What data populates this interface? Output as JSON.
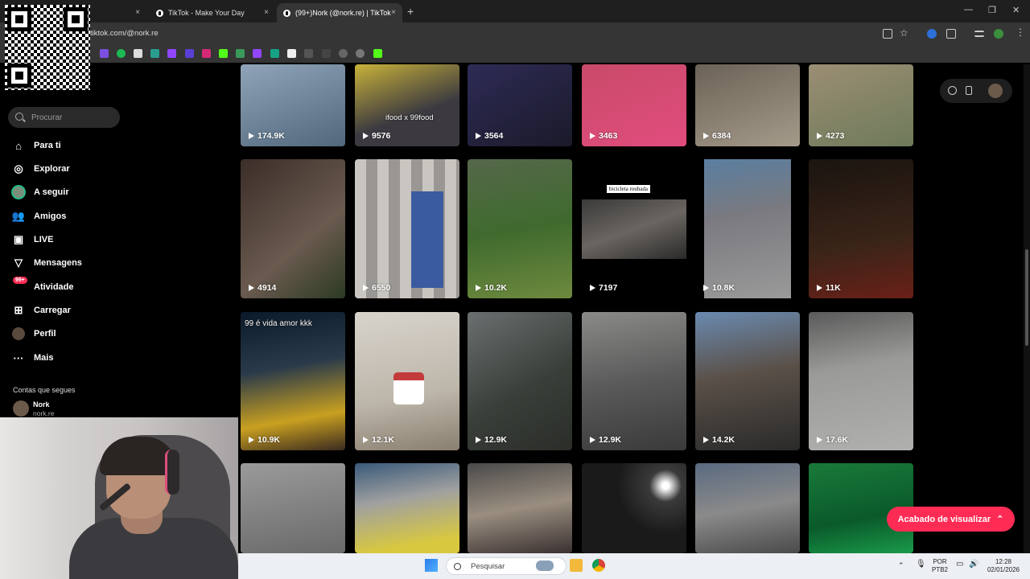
{
  "browser": {
    "tabs": [
      {
        "label": "TikTok - Make Your Day",
        "close": "×"
      },
      {
        "label": "(99+)Nork (@nork.re) | TikTok",
        "close": "×"
      }
    ],
    "new_tab": "+",
    "url": "tiktok.com/@nork.re",
    "window_controls": [
      "—",
      "❐",
      "✕"
    ]
  },
  "sidebar": {
    "search_placeholder": "Procurar",
    "items": [
      {
        "label": "Para ti",
        "icon": "home-icon"
      },
      {
        "label": "Explorar",
        "icon": "compass-icon"
      },
      {
        "label": "A seguir",
        "icon": "avatar-icon"
      },
      {
        "label": "Amigos",
        "icon": "friends-icon"
      },
      {
        "label": "LIVE",
        "icon": "live-icon"
      },
      {
        "label": "Mensagens",
        "icon": "messages-icon"
      },
      {
        "label": "Atividade",
        "icon": "activity-icon",
        "badge": "99+"
      },
      {
        "label": "Carregar",
        "icon": "upload-icon"
      },
      {
        "label": "Perfil",
        "icon": "profile-icon"
      },
      {
        "label": "Mais",
        "icon": "more-icon"
      }
    ],
    "following_title": "Contas que segues",
    "following": [
      {
        "name": "Nork",
        "handle": "nork.re"
      }
    ]
  },
  "videos": [
    {
      "views": "174.9K"
    },
    {
      "views": "9576",
      "overlay": "ifood x 99food"
    },
    {
      "views": "3564"
    },
    {
      "views": "3463"
    },
    {
      "views": "6384"
    },
    {
      "views": "4273"
    },
    {
      "views": "4914"
    },
    {
      "views": "6550"
    },
    {
      "views": "10.2K"
    },
    {
      "views": "7197",
      "overlay": "bicicleta roubada"
    },
    {
      "views": "10.8K"
    },
    {
      "views": "11K"
    },
    {
      "views": "10.9K",
      "overlay": "99 é vida amor kkk"
    },
    {
      "views": "12.1K"
    },
    {
      "views": "12.9K"
    },
    {
      "views": "12.9K"
    },
    {
      "views": "14.2K"
    },
    {
      "views": "17.6K"
    },
    {
      "views": ""
    },
    {
      "views": ""
    },
    {
      "views": ""
    },
    {
      "views": ""
    },
    {
      "views": ""
    },
    {
      "views": ""
    }
  ],
  "finished_button": "Acabado de visualizar",
  "taskbar": {
    "search_placeholder": "Pesquisar",
    "lang_top": "POR",
    "lang_bottom": "PTB2",
    "time": "12:28",
    "date": "02/01/2026"
  },
  "colors": {
    "accent": "#fe2c55",
    "background": "#000000"
  }
}
